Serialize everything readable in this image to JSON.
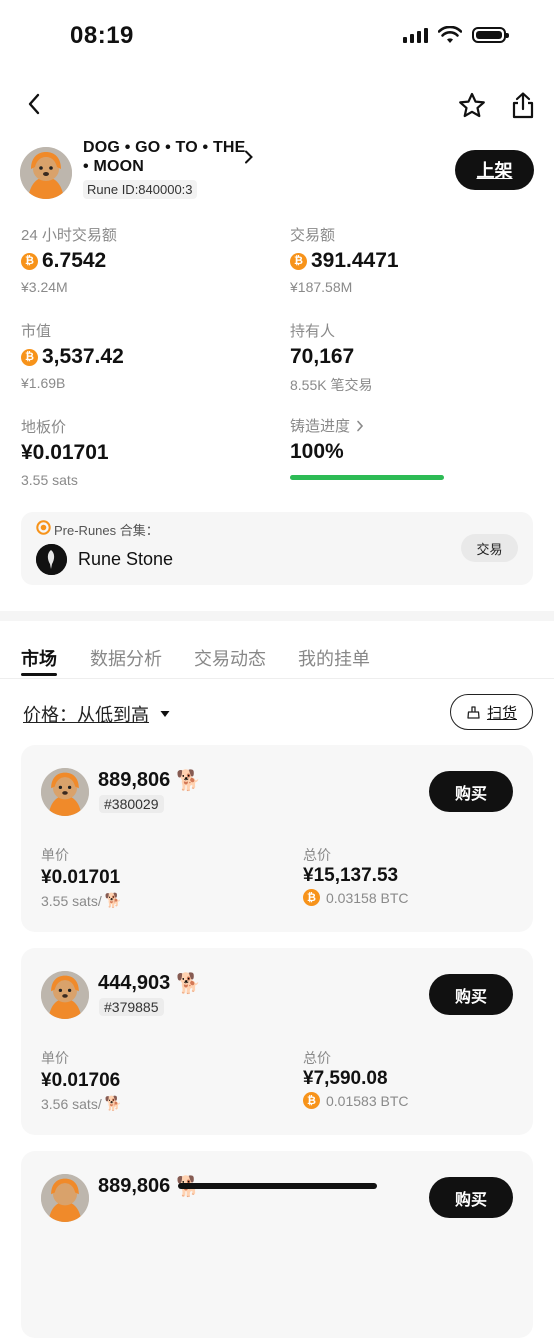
{
  "status_bar": {
    "time": "08:19"
  },
  "header": {
    "back_icon": "chevron-left-icon",
    "favorite_icon": "star-icon",
    "share_icon": "share-icon"
  },
  "token": {
    "name": "DOG • GO • TO • THE • MOON",
    "rune_id": "Rune ID:840000:3",
    "list_label": "上架"
  },
  "stats": {
    "vol24_label": "24 小时交易额",
    "vol24_value": "6.7542",
    "vol24_sub": "¥3.24M",
    "volume_label": "交易额",
    "volume_value": "391.4471",
    "volume_sub": "¥187.58M",
    "mcap_label": "市值",
    "mcap_value": "3,537.42",
    "mcap_sub": "¥1.69B",
    "holders_label": "持有人",
    "holders_value": "70,167",
    "holders_sub": "8.55K 笔交易",
    "floor_label": "地板价",
    "floor_value": "¥0.01701",
    "floor_sub": "3.55 sats",
    "mint_label": "铸造进度",
    "mint_value": "100%",
    "mint_progress": 1.0
  },
  "collection": {
    "label": "Pre-Runes 合集：",
    "name": "Rune Stone",
    "trade_label": "交易"
  },
  "tabs": [
    {
      "label": "市场",
      "active": true
    },
    {
      "label": "数据分析",
      "active": false
    },
    {
      "label": "交易动态",
      "active": false
    },
    {
      "label": "我的挂单",
      "active": false
    }
  ],
  "sort": {
    "label": "价格：从低到高"
  },
  "sweep": {
    "label": "扫货"
  },
  "listings": [
    {
      "quantity": "889,806",
      "id": "#380029",
      "buy_label": "购买",
      "unit_label": "单价",
      "unit_price": "¥0.01701",
      "unit_sats": "3.55 sats/",
      "total_label": "总价",
      "total_price": "¥15,137.53",
      "total_btc": "0.03158 BTC"
    },
    {
      "quantity": "444,903",
      "id": "#379885",
      "buy_label": "购买",
      "unit_label": "单价",
      "unit_price": "¥0.01706",
      "unit_sats": "3.56 sats/",
      "total_label": "总价",
      "total_price": "¥7,590.08",
      "total_btc": "0.01583 BTC"
    },
    {
      "quantity": "889,806",
      "buy_label": "购买"
    }
  ],
  "colors": {
    "accent": "#111111",
    "btc": "#f7931a",
    "progress": "#2dbb55"
  }
}
